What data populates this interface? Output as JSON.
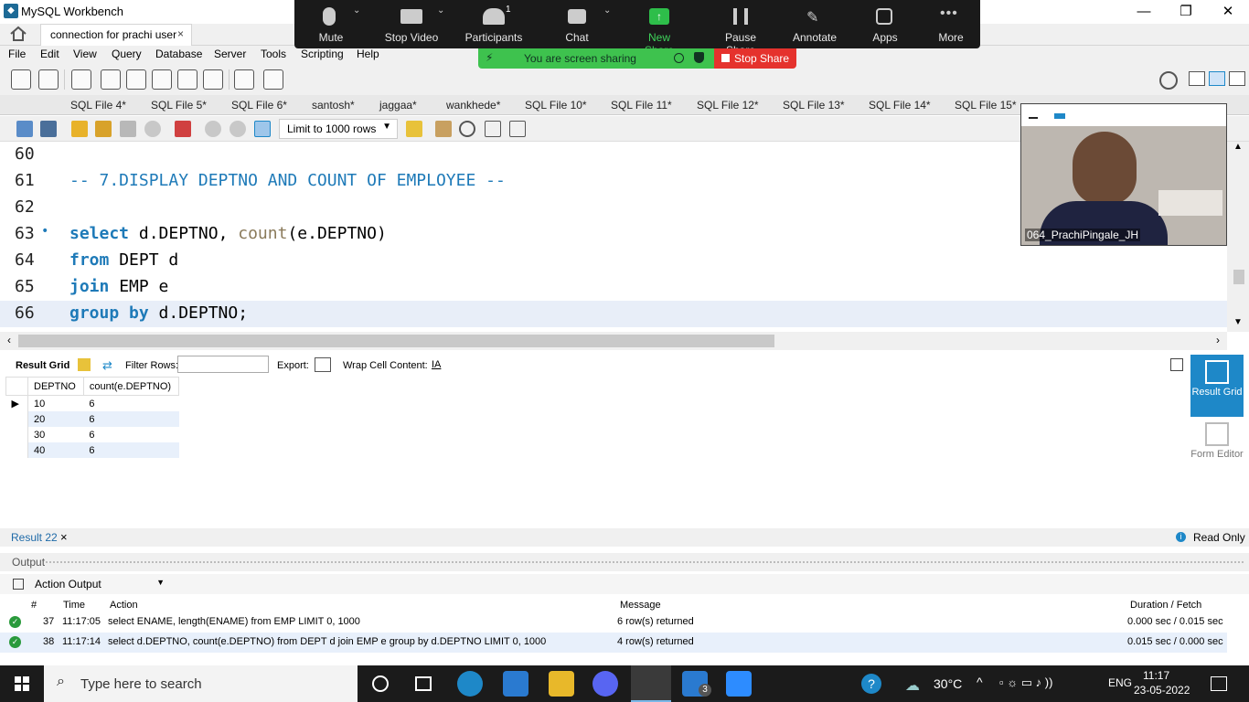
{
  "window": {
    "title": "MySQL Workbench",
    "minimize": "—",
    "maximize": "❐",
    "close": "✕"
  },
  "connection_tab": {
    "label": "connection for prachi user",
    "close": "×"
  },
  "menu": [
    "File",
    "Edit",
    "View",
    "Query",
    "Database",
    "Server",
    "Tools",
    "Scripting",
    "Help"
  ],
  "file_tabs": [
    "SQL File 4*",
    "SQL File 5*",
    "SQL File 6*",
    "santosh*",
    "jaggaa*",
    "wankhede*",
    "SQL File 10*",
    "SQL File 11*",
    "SQL File 12*",
    "SQL File 13*",
    "SQL File 14*",
    "SQL File 15*"
  ],
  "editor_toolbar": {
    "limit_label": "Limit to 1000 rows"
  },
  "editor": {
    "lines": [
      {
        "num": "60"
      },
      {
        "num": "61",
        "comment": "-- 7.DISPLAY DEPTNO AND COUNT OF EMPLOYEE --"
      },
      {
        "num": "62"
      },
      {
        "num": "63",
        "marker": "•",
        "kw": "select",
        "rest1": " d.DEPTNO, ",
        "fn": "count",
        "rest2": "(e.DEPTNO)"
      },
      {
        "num": "64",
        "kw": "from",
        "rest1": " DEPT d"
      },
      {
        "num": "65",
        "kw": "join",
        "rest1": " EMP e"
      },
      {
        "num": "66",
        "kw": "group by",
        "rest1": " d.DEPTNO;"
      }
    ]
  },
  "result_toolbar": {
    "result_grid": "Result Grid",
    "filter_rows": "Filter Rows:",
    "export": "Export:",
    "wrap": "Wrap Cell Content:"
  },
  "result_grid": {
    "columns": [
      "DEPTNO",
      "count(e.DEPTNO)"
    ],
    "rows": [
      [
        "10",
        "6"
      ],
      [
        "20",
        "6"
      ],
      [
        "30",
        "6"
      ],
      [
        "40",
        "6"
      ]
    ]
  },
  "side_panel": {
    "result_grid": "Result Grid",
    "form_editor": "Form Editor"
  },
  "result_tab": {
    "label": "Result 22",
    "close": "×",
    "read_only": "Read Only"
  },
  "output": {
    "header": "Output",
    "selector": "Action Output",
    "columns": {
      "num": "#",
      "time": "Time",
      "action": "Action",
      "message": "Message",
      "duration": "Duration / Fetch"
    },
    "rows": [
      {
        "num": "37",
        "time": "11:17:05",
        "action": "select ENAME, length(ENAME) from EMP LIMIT 0, 1000",
        "message": "6 row(s) returned",
        "duration": "0.000 sec / 0.015 sec"
      },
      {
        "num": "38",
        "time": "11:17:14",
        "action": "select d.DEPTNO, count(e.DEPTNO)  from DEPT d join EMP e group by d.DEPTNO LIMIT 0, 1000",
        "message": "4 row(s) returned",
        "duration": "0.015 sec / 0.000 sec"
      }
    ]
  },
  "zoom": {
    "items": [
      "Mute",
      "Stop Video",
      "Participants",
      "Chat",
      "New Share",
      "Pause Share",
      "Annotate",
      "Apps",
      "More"
    ],
    "participants_count": "1",
    "sharing_text": "You are screen sharing",
    "stop_share": "Stop Share"
  },
  "video": {
    "name": "064_PrachiPingale_JH"
  },
  "taskbar": {
    "search_placeholder": "Type here to search",
    "temperature": "30°C",
    "language": "ENG",
    "time": "11:17",
    "date": "23-05-2022",
    "mail_badge": "3"
  },
  "colors": {
    "accent": "#1e88c8",
    "keyword": "#1e7ab8",
    "share_green": "#3ec24e",
    "stop_red": "#e5322d"
  }
}
